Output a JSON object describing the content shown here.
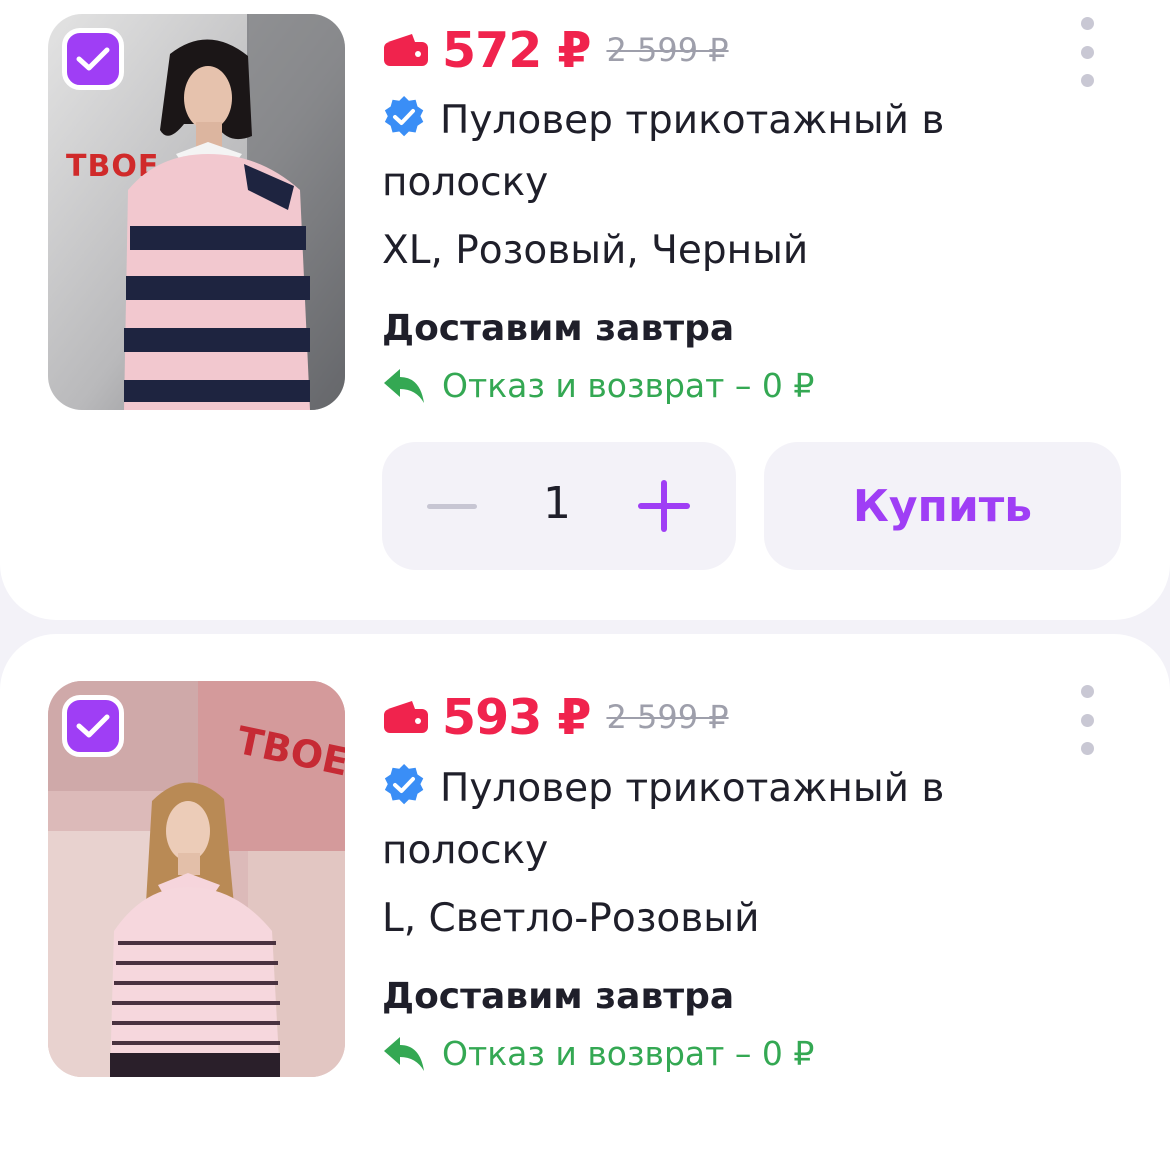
{
  "colors": {
    "accent": "#9f3ef5",
    "price": "#f0234d",
    "old_price": "#9e9fab",
    "success": "#34a853",
    "verified": "#3a8ef6",
    "surface": "#f3f2f8"
  },
  "products": [
    {
      "selected": true,
      "image_icon": "product-photo",
      "image_brand_text": "ТВОЕ",
      "price": "572 ₽",
      "old_price": "2 599 ₽",
      "title": "Пуловер трикотажный в полоску",
      "variant": "XL, Розовый, Черный",
      "delivery": "Доставим завтра",
      "return_policy": "Отказ и возврат – 0 ₽",
      "quantity": "1",
      "buy_label": "Купить"
    },
    {
      "selected": true,
      "image_icon": "product-photo",
      "image_brand_text": "ТВОЕ",
      "price": "593 ₽",
      "old_price": "2 599 ₽",
      "title": "Пуловер трикотажный в полоску",
      "variant": "L, Светло-Розовый",
      "delivery": "Доставим завтра",
      "return_policy": "Отказ и возврат – 0 ₽"
    }
  ]
}
